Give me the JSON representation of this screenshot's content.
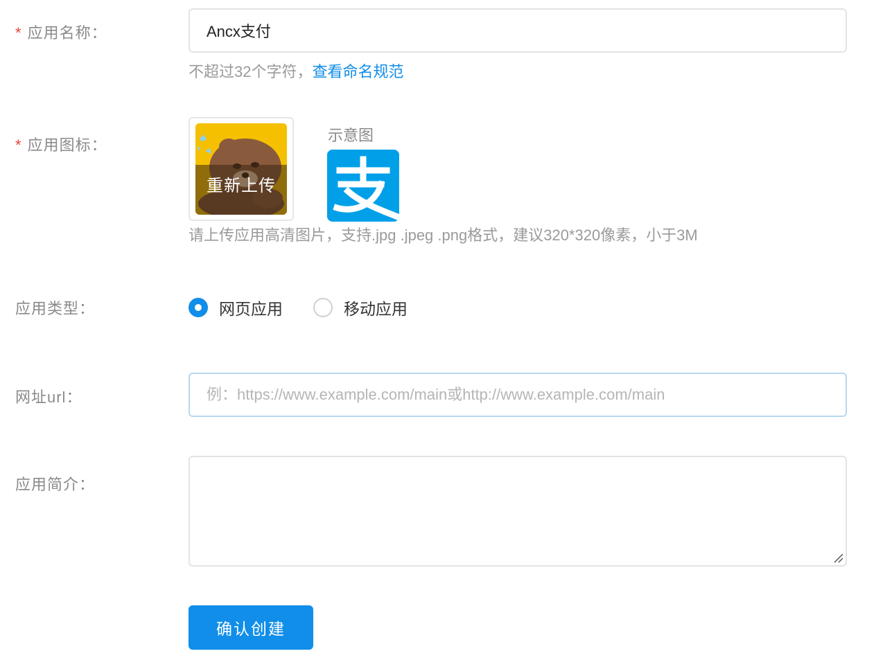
{
  "form": {
    "app_name": {
      "required_mark": "*",
      "label": "应用名称：",
      "value": "Ancx支付",
      "hint_text": "不超过32个字符，",
      "hint_link": "查看命名规范"
    },
    "app_icon": {
      "required_mark": "*",
      "label": "应用图标：",
      "upload_overlay_text": "重新上传",
      "sample_label": "示意图",
      "sample_icon_glyph": "支",
      "hint": "请上传应用高清图片，支持.jpg .jpeg .png格式，建议320*320像素，小于3M"
    },
    "app_type": {
      "label": "应用类型：",
      "options": [
        {
          "label": "网页应用",
          "checked": true
        },
        {
          "label": "移动应用",
          "checked": false
        }
      ]
    },
    "url": {
      "label": "网址url：",
      "value": "",
      "placeholder": "例：https://www.example.com/main或http://www.example.com/main"
    },
    "intro": {
      "label": "应用简介：",
      "value": ""
    },
    "submit_label": "确认创建"
  },
  "colors": {
    "accent": "#108ee9",
    "required": "#f04134",
    "sample_icon_bg": "#00a0e9"
  },
  "icons": [
    "uploaded-bear-image",
    "alipay-logo-icon",
    "resize-grip-icon"
  ]
}
